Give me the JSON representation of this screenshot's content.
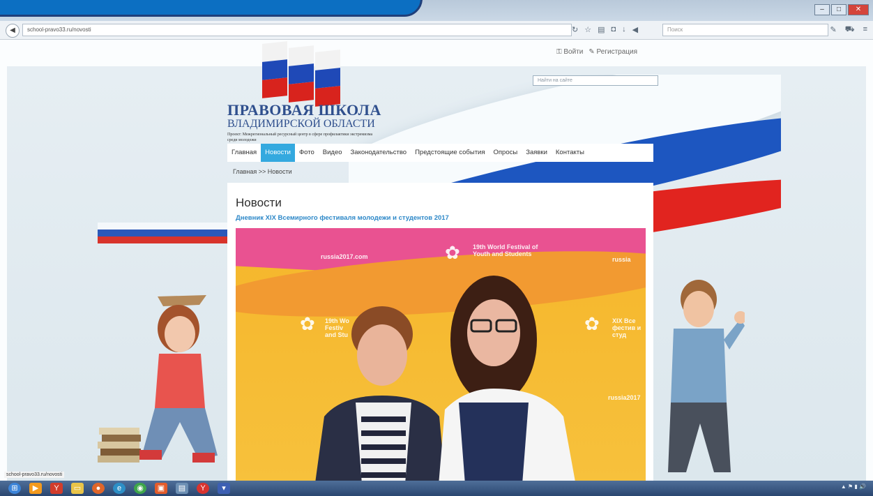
{
  "browser": {
    "url": "school-pravo33.ru/novosti",
    "search_placeholder": "Поиск"
  },
  "header": {
    "login": "Войти",
    "register": "Регистрация",
    "site_search_placeholder": "Найти на сайте",
    "title_line1": "ПРАВОВАЯ ШКОЛА",
    "title_line2": "ВЛАДИМИРСКОЙ ОБЛАСТИ",
    "subtitle": "Проект: Межрегиональный ресурсный центр в сфере профилактики экстремизма среди молодежи"
  },
  "menu": {
    "items": [
      "Главная",
      "Новости",
      "Фото",
      "Видео",
      "Законодательство",
      "Предстоящие события",
      "Опросы",
      "Заявки",
      "Контакты"
    ],
    "active_index": 1
  },
  "breadcrumb": "Главная >> Новости",
  "content": {
    "heading": "Новости",
    "article_link": "Дневник XIX Всемирного фестиваля молодежи и студентов 2017",
    "photo_texts": {
      "site": "russia2017.com",
      "festival": "19th World Festival of Youth and Students",
      "festival_short": "19th Wo Festiv and Stu",
      "festival_ru": "XIX Все фестив и студ",
      "right_top": "russia",
      "right_mid": "russia2017"
    }
  },
  "status_bar_url": "school-pravo33.ru/novosti",
  "colors": {
    "accent": "#34a9df",
    "title": "#2f4f8d",
    "link": "#2d88c8",
    "flag_blue": "#1d56c0",
    "flag_red": "#e1241f"
  }
}
